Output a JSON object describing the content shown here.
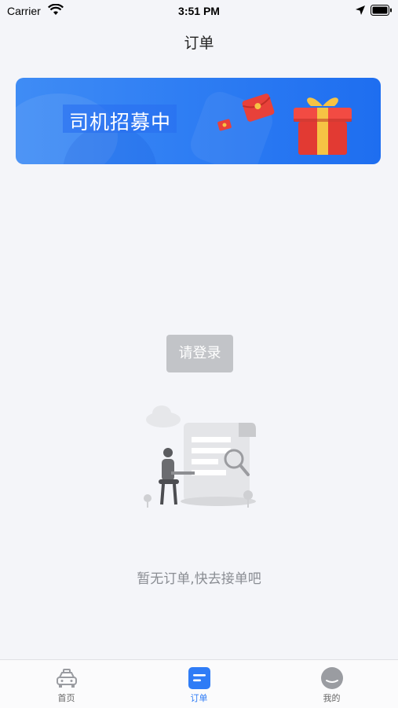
{
  "status_bar": {
    "carrier": "Carrier",
    "time": "3:51 PM"
  },
  "nav": {
    "title": "订单"
  },
  "banner": {
    "label": "司机招募中"
  },
  "login_button": "请登录",
  "empty_state": {
    "text": "暂无订单,快去接单吧"
  },
  "tabs": [
    {
      "label": "首页",
      "icon": "car-icon",
      "active": false
    },
    {
      "label": "订单",
      "icon": "order-list-icon",
      "active": true
    },
    {
      "label": "我的",
      "icon": "profile-face-icon",
      "active": false
    }
  ],
  "colors": {
    "accent": "#2f7cf6",
    "banner_blue": "#2f7ef3",
    "page_bg": "#f4f5f9",
    "muted_text": "#8a8d93"
  }
}
